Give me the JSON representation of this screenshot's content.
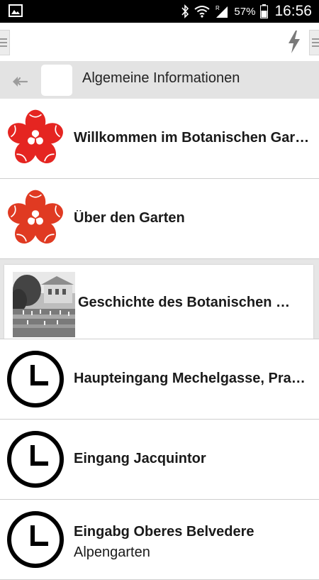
{
  "status_bar": {
    "battery_percent": "57%",
    "time": "16:56"
  },
  "toolbar": {
    "left_icon": "drawer-handle-icon",
    "right_icons": [
      "bolt-icon",
      "drawer-handle-icon"
    ]
  },
  "section_header": {
    "title": "Algemeine Informationen"
  },
  "colors": {
    "accent_red": "#e52521",
    "header_bg": "#e3e3e3",
    "selected_bg": "#e6e6e6"
  },
  "list": [
    {
      "title": "Willkommen im Botanischen Garten",
      "icon": "flower-logo-icon"
    },
    {
      "title": "Über den Garten",
      "icon": "flower-logo-icon"
    },
    {
      "title": "Geschichte des Botanischen Gartens",
      "icon": "garden-photo",
      "selected": true
    },
    {
      "title": "Haupteingang Mechelgasse, Praetoriusgasse",
      "icon": "clock-icon"
    },
    {
      "title": "Eingang Jacquintor",
      "icon": "clock-icon"
    },
    {
      "title": "Eingabg Oberes Belvedere",
      "subtitle": "Alpengarten",
      "icon": "clock-icon"
    }
  ]
}
